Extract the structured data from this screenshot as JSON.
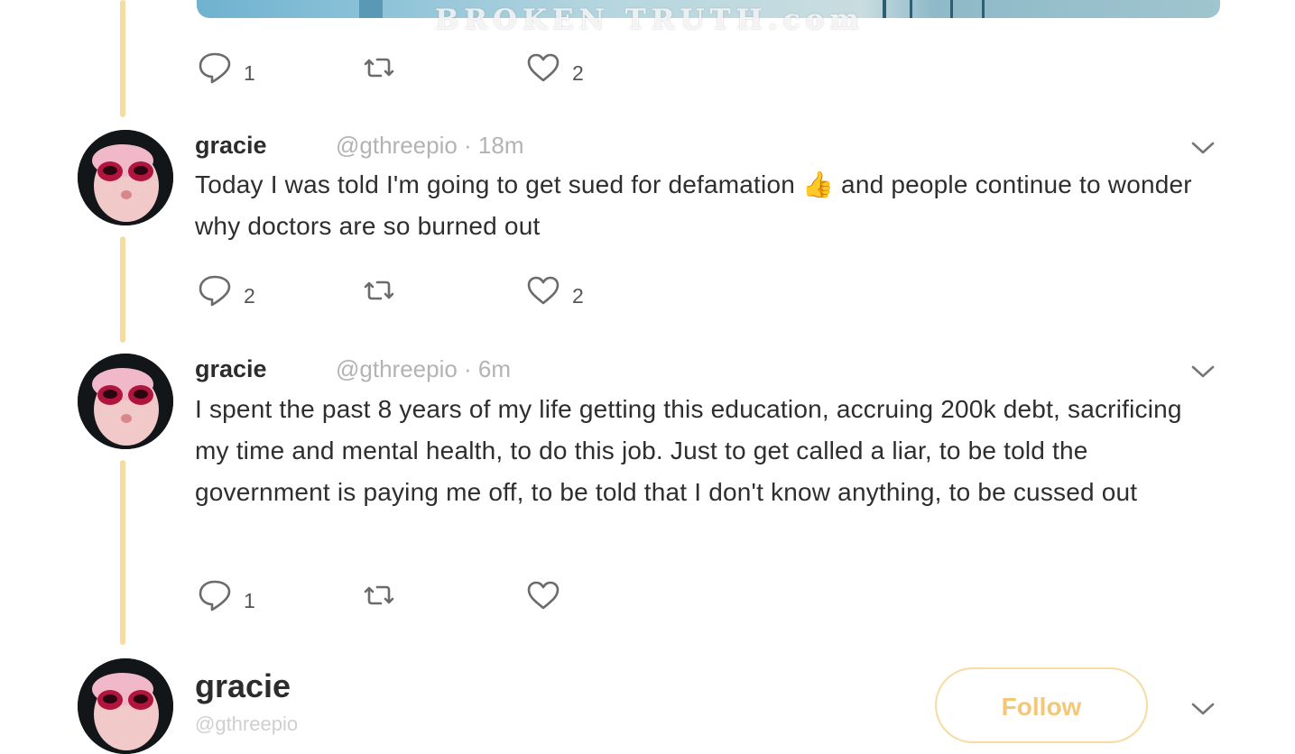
{
  "watermark": "BROKEN TRUTH.com",
  "colors": {
    "accent": "#f6dca0",
    "follow_text": "#f2c878",
    "meta": "#b3b3b3"
  },
  "top_tweet_actions": {
    "replies": "1",
    "retweets": "",
    "likes": "2"
  },
  "tweets": [
    {
      "name": "gracie",
      "handle": "@gthreepio",
      "time": "· 18m",
      "text_before_emoji": "Today I was told I'm going to get sued for defamation ",
      "emoji": "👍",
      "text_after_emoji": " and people continue to wonder why doctors are so burned out",
      "replies": "2",
      "retweets": "",
      "likes": "2"
    },
    {
      "name": "gracie",
      "handle": "@gthreepio",
      "time": "· 6m",
      "text": "I spent the past 8 years of my life getting this education, accruing 200k debt, sacrificing my time and mental health, to do this job. Just to get called a liar, to be told the government is paying me off, to be told that I don't know anything, to be cussed out",
      "replies": "1",
      "retweets": "",
      "likes": ""
    }
  ],
  "profile_card": {
    "name": "gracie",
    "handle_partial": "@gthreepio",
    "follow_label": "Follow"
  },
  "icons": [
    "reply-icon",
    "retweet-icon",
    "like-icon",
    "chevron-down-icon",
    "avatar"
  ]
}
